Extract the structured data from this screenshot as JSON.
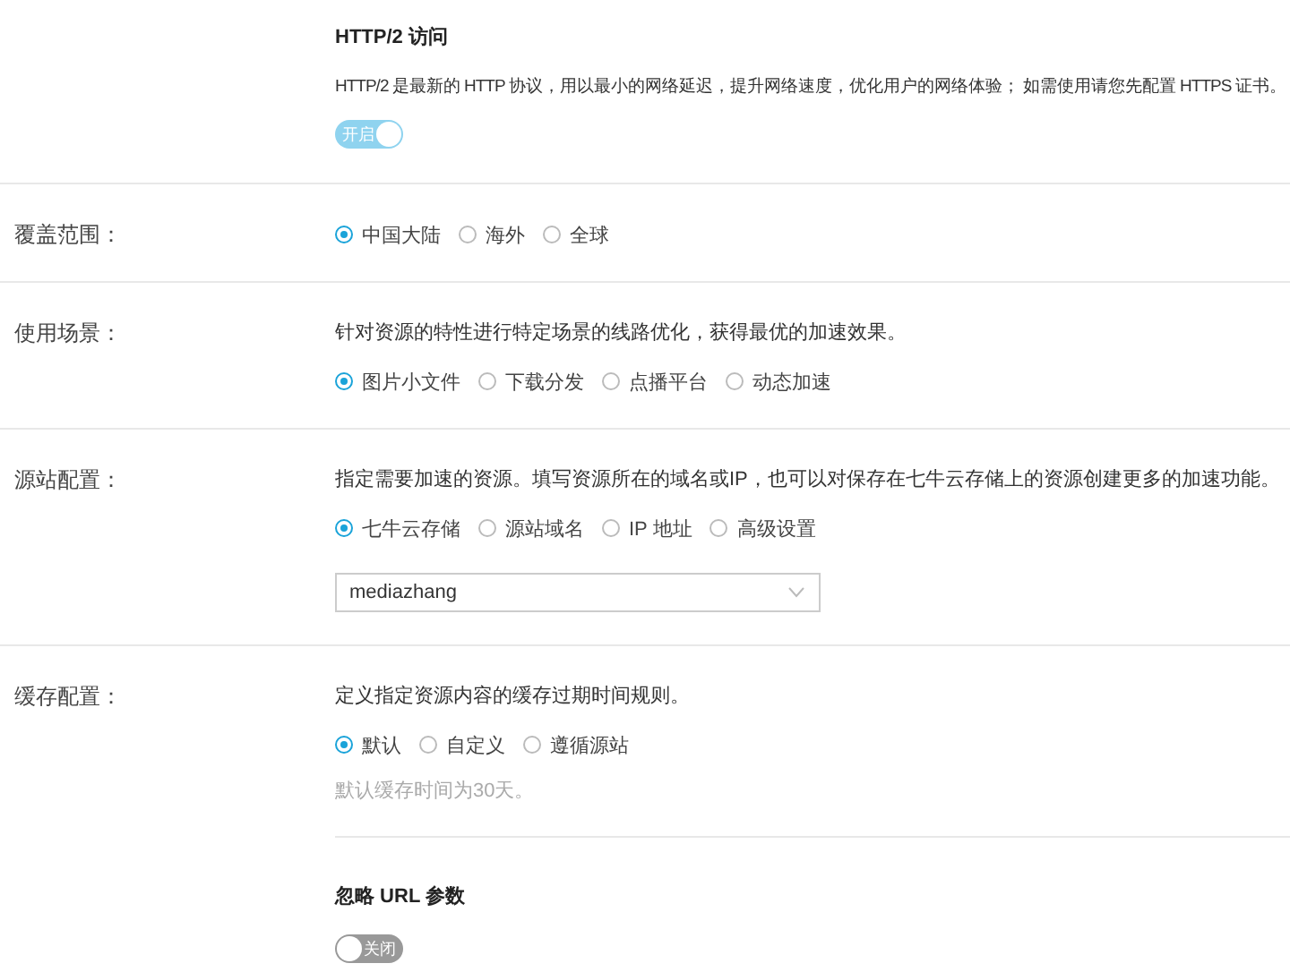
{
  "http2": {
    "title": "HTTP/2 访问",
    "description": "HTTP/2 是最新的 HTTP 协议，用以最小的网络延迟，提升网络速度，优化用户的网络体验； 如需使用请您先配置 HTTPS 证书。",
    "toggle": {
      "label": "开启",
      "on": true
    }
  },
  "sections": [
    {
      "label": "覆盖范围：",
      "options": [
        {
          "label": "中国大陆",
          "selected": true
        },
        {
          "label": "海外",
          "selected": false
        },
        {
          "label": "全球",
          "selected": false
        }
      ]
    },
    {
      "label": "使用场景：",
      "description": "针对资源的特性进行特定场景的线路优化，获得最优的加速效果。",
      "options": [
        {
          "label": "图片小文件",
          "selected": true
        },
        {
          "label": "下载分发",
          "selected": false
        },
        {
          "label": "点播平台",
          "selected": false
        },
        {
          "label": "动态加速",
          "selected": false
        }
      ]
    },
    {
      "label": "源站配置：",
      "description": "指定需要加速的资源。填写资源所在的域名或IP，也可以对保存在七牛云存储上的资源创建更多的加速功能。",
      "options": [
        {
          "label": "七牛云存储",
          "selected": true
        },
        {
          "label": "源站域名",
          "selected": false
        },
        {
          "label": "IP 地址",
          "selected": false
        },
        {
          "label": "高级设置",
          "selected": false
        }
      ],
      "select": {
        "value": "mediazhang"
      }
    },
    {
      "label": "缓存配置：",
      "description": "定义指定资源内容的缓存过期时间规则。",
      "options": [
        {
          "label": "默认",
          "selected": true
        },
        {
          "label": "自定义",
          "selected": false
        },
        {
          "label": "遵循源站",
          "selected": false
        }
      ],
      "hint": "默认缓存时间为30天。",
      "subsection": {
        "title": "忽略 URL 参数",
        "toggle": {
          "label": "关闭",
          "on": false
        }
      }
    }
  ]
}
